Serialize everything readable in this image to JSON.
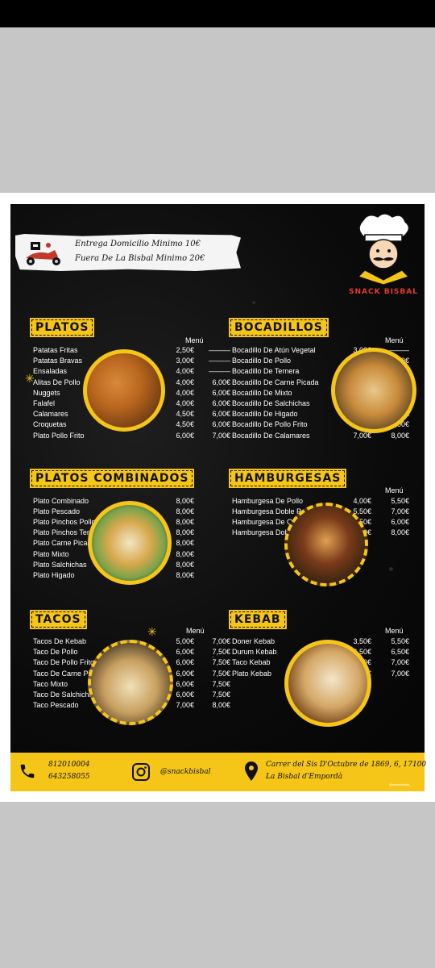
{
  "delivery": {
    "line1": "Entrega Domicilio Minimo 10€",
    "line2": "Fuera De La Bisbal Minimo 20€"
  },
  "brand": "SNACK BISBAL",
  "menu_column_label": "Menú",
  "no_menu_mark": "———",
  "platos": {
    "title": "PLATOS",
    "items": [
      {
        "name": "Patatas Fritas",
        "price": "2,50€",
        "menu": "———"
      },
      {
        "name": "Patatas Bravas",
        "price": "3,00€",
        "menu": "———"
      },
      {
        "name": "Ensaladas",
        "price": "4,00€",
        "menu": "———"
      },
      {
        "name": "Alitas De Pollo",
        "price": "4,00€",
        "menu": "6,00€"
      },
      {
        "name": "Nuggets",
        "price": "4,00€",
        "menu": "6,00€"
      },
      {
        "name": "Falafel",
        "price": "4,00€",
        "menu": "6,00€"
      },
      {
        "name": "Calamares",
        "price": "4,50€",
        "menu": "6,00€"
      },
      {
        "name": "Croquetas",
        "price": "4,50€",
        "menu": "6,00€"
      },
      {
        "name": "Plato Pollo Frito",
        "price": "6,00€",
        "menu": "7,00€"
      }
    ]
  },
  "bocadillos": {
    "title": "BOCADILLOS",
    "items": [
      {
        "name": "Bocadillo De Atún Vegetal",
        "price": "3,00€",
        "menu": "———"
      },
      {
        "name": "Bocadillo De Pollo",
        "price": "5,00€",
        "menu": "6,00€"
      },
      {
        "name": "Bocadillo De Ternera",
        "price": "5,00€",
        "menu": "6,00€"
      },
      {
        "name": "Bocadillo De Carne Picada",
        "price": "5,00€",
        "menu": "6,00€"
      },
      {
        "name": "Bocadillo De Mixto",
        "price": "5,00€",
        "menu": "6,00€"
      },
      {
        "name": "Bocadillo De Salchichas",
        "price": "5,00€",
        "menu": "6,00€"
      },
      {
        "name": "Bocadillo De Higado",
        "price": "5,00€",
        "menu": "6,00€"
      },
      {
        "name": "Bocadillo De Pollo Frito",
        "price": "5,00€",
        "menu": "7,00€"
      },
      {
        "name": "Bocadillo De Calamares",
        "price": "7,00€",
        "menu": "8,00€"
      }
    ]
  },
  "combinados": {
    "title": "PLATOS COMBINADOS",
    "items": [
      {
        "name": "Plato Combinado",
        "price": "8,00€"
      },
      {
        "name": "Plato Pescado",
        "price": "8,00€"
      },
      {
        "name": "Plato Pinchos Pollo",
        "price": "8,00€"
      },
      {
        "name": "Plato Pinchos Ternera",
        "price": "8,00€"
      },
      {
        "name": "Plato Carne Picada Ternera",
        "price": "8,00€"
      },
      {
        "name": "Plato Mixto",
        "price": "8,00€"
      },
      {
        "name": "Plato Salchichas",
        "price": "8,00€"
      },
      {
        "name": "Plato Higado",
        "price": "8,00€"
      }
    ]
  },
  "hamburgesas": {
    "title": "HAMBURGESAS",
    "items": [
      {
        "name": "Hamburgesa De Pollo",
        "price": "4,00€",
        "menu": "5,50€"
      },
      {
        "name": "Hamburgesa Doble Pollo",
        "price": "5,50€",
        "menu": "7,00€"
      },
      {
        "name": "Hamburgesa De Carne",
        "price": "4,50€",
        "menu": "6,00€"
      },
      {
        "name": "Hamburgesa Doble Carne",
        "price": "6,50€",
        "menu": "8,00€"
      }
    ]
  },
  "tacos": {
    "title": "TACOS",
    "items": [
      {
        "name": "Tacos De Kebab",
        "price": "5,00€",
        "menu": "7,00€"
      },
      {
        "name": "Taco De Pollo",
        "price": "6,00€",
        "menu": "7,50€"
      },
      {
        "name": "Taco De Pollo Frito",
        "price": "6,00€",
        "menu": "7,50€"
      },
      {
        "name": "Taco De Carne Picada",
        "price": "6,00€",
        "menu": "7,50€"
      },
      {
        "name": "Taco Mixto",
        "price": "6,00€",
        "menu": "7,50€"
      },
      {
        "name": "Taco De Salchichas",
        "price": "6,00€",
        "menu": "7,50€"
      },
      {
        "name": "Taco Pescado",
        "price": "7,00€",
        "menu": "8,00€"
      }
    ]
  },
  "kebab": {
    "title": "KEBAB",
    "items": [
      {
        "name": "Doner Kebab",
        "price": "3,50€",
        "menu": "5,50€"
      },
      {
        "name": "Durum Kebab",
        "price": "4,50€",
        "menu": "6,50€"
      },
      {
        "name": "Taco Kebab",
        "price": "5,00€",
        "menu": "7,00€"
      },
      {
        "name": "Plato Kebab",
        "price": "6,00€",
        "menu": "7,00€"
      }
    ]
  },
  "footer": {
    "phone1": "812010004",
    "phone2": "643258055",
    "instagram": "@snackbisbal",
    "address1": "Carrer del Sis D'Octubre de 1869, 6, 17100",
    "address2": "La Bisbal d'Empordà",
    "tag": "@snackbisbal_"
  },
  "colors": {
    "accent": "#f5c518",
    "brand_red": "#e23b2e",
    "background": "#0b0b0b"
  }
}
